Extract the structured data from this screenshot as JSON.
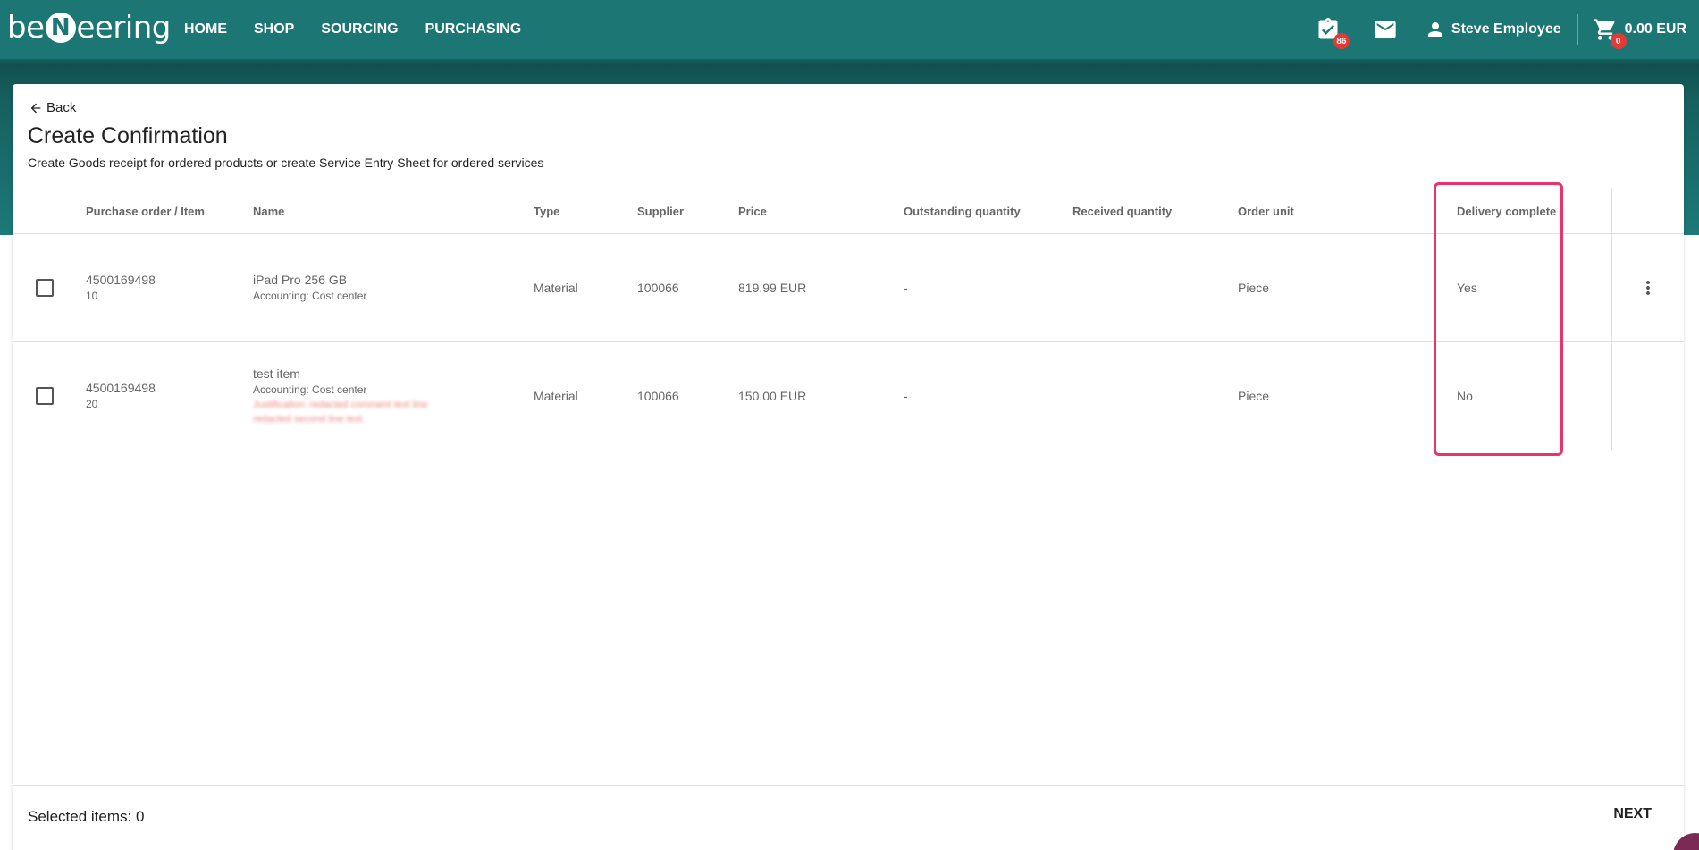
{
  "header": {
    "logo": {
      "before": "be",
      "letter": "N",
      "after": "eering"
    },
    "nav": [
      "HOME",
      "SHOP",
      "SOURCING",
      "PURCHASING"
    ],
    "tasks_badge": "86",
    "user_name": "Steve Employee",
    "cart_badge": "0",
    "cart_total": "0.00 EUR"
  },
  "page": {
    "back_label": "Back",
    "title": "Create Confirmation",
    "subtitle": "Create Goods receipt for ordered products or create Service Entry Sheet for ordered services"
  },
  "table": {
    "columns": [
      "Purchase order / Item",
      "Name",
      "Type",
      "Supplier",
      "Price",
      "Outstanding quantity",
      "Received quantity",
      "Order unit",
      "Delivery complete"
    ],
    "rows": [
      {
        "po": "4500169498",
        "item": "10",
        "name": "iPad Pro 256 GB",
        "accounting": "Accounting:  Cost center",
        "blurred": [
          "",
          ""
        ],
        "type": "Material",
        "supplier": "100066",
        "price": "819.99 EUR",
        "outstanding": "-",
        "received": "",
        "unit": "Piece",
        "delivery_complete": "Yes"
      },
      {
        "po": "4500169498",
        "item": "20",
        "name": "test item",
        "accounting": "Accounting:  Cost center",
        "blurred": [
          "Justification: redacted comment text line",
          "redacted second line text"
        ],
        "type": "Material",
        "supplier": "100066",
        "price": "150.00 EUR",
        "outstanding": "-",
        "received": "",
        "unit": "Piece",
        "delivery_complete": "No"
      }
    ]
  },
  "footer": {
    "selected_label": "Selected items: 0",
    "next_label": "NEXT"
  },
  "colors": {
    "header_bg": "#1c7674",
    "highlight": "#e8336b",
    "badge": "#e53935"
  }
}
